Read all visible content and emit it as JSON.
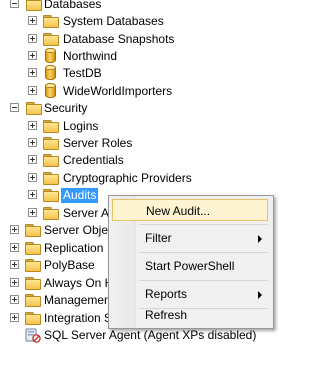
{
  "tree": {
    "databases": "Databases",
    "system_databases": "System Databases",
    "database_snapshots": "Database Snapshots",
    "northwind": "Northwind",
    "testdb": "TestDB",
    "wideworld": "WideWorldImporters",
    "security": "Security",
    "logins": "Logins",
    "server_roles": "Server Roles",
    "credentials": "Credentials",
    "crypto_providers": "Cryptographic Providers",
    "audits": "Audits",
    "server_audit_specs": "Server Audit Specifications",
    "server_objects": "Server Objects",
    "replication": "Replication",
    "polybase": "PolyBase",
    "always_on": "Always On High Availability",
    "management": "Management",
    "integration": "Integration Services Catalogs",
    "sql_agent": "SQL Server Agent (Agent XPs disabled)"
  },
  "context_menu": {
    "new_audit": "New Audit...",
    "filter": "Filter",
    "start_powershell": "Start PowerShell",
    "reports": "Reports",
    "refresh": "Refresh"
  }
}
